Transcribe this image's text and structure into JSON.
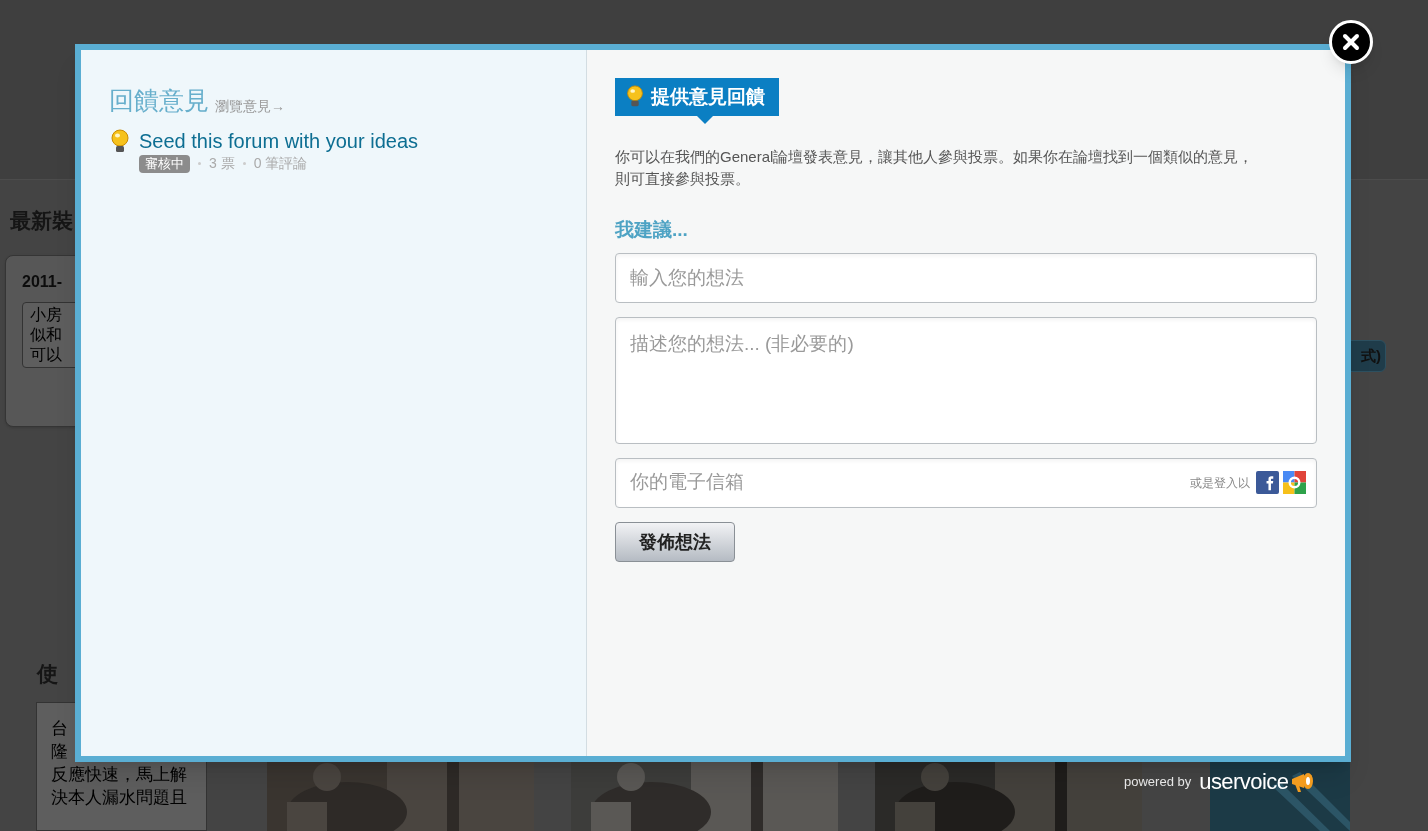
{
  "background_page": {
    "section_title": "最新裝",
    "card": {
      "date": "2011-",
      "lines": [
        "小房",
        "似和",
        "可以"
      ]
    },
    "section_title_2": "使",
    "card_2": {
      "lines": [
        "台",
        "隆",
        "反應快速，馬上解",
        "決本人漏水問題且"
      ]
    },
    "side_button": "式)"
  },
  "modal": {
    "left": {
      "title": "回饋意見",
      "browse_link": "瀏覽意見→",
      "ideas": [
        {
          "title": "Seed this forum with your ideas",
          "status": "審核中",
          "votes": "3 票",
          "comments": "0 筆評論"
        }
      ]
    },
    "right": {
      "header": "提供意見回饋",
      "description": "你可以在我們的General論壇發表意見，讓其他人參與投票。如果你在論壇找到一個類似的意見，則可直接參與投票。",
      "suggest_label": "我建議...",
      "idea_field": {
        "placeholder": "輸入您的想法"
      },
      "details_field": {
        "placeholder": "描述您的想法... (非必要的)"
      },
      "email_field": {
        "placeholder": "你的電子信箱",
        "login_hint": "或是登入以"
      },
      "submit_button": "發佈想法"
    }
  },
  "powered_by": {
    "label": "powered by",
    "brand": "uservoice"
  }
}
